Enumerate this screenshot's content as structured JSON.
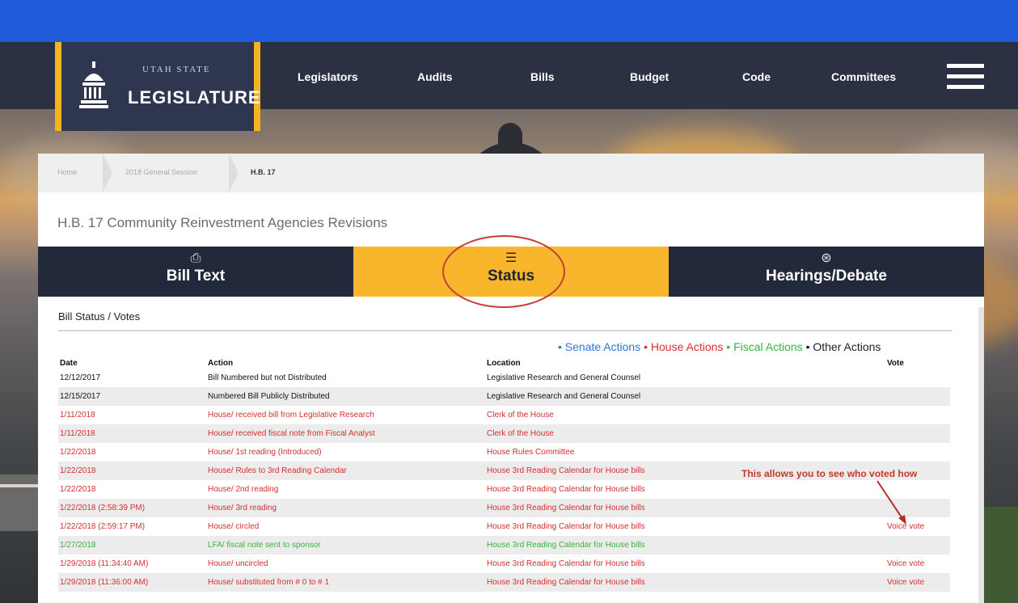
{
  "logo": {
    "top_text": "UTAH STATE",
    "main_text": "LEGISLATURE"
  },
  "nav": {
    "links": [
      "Legislators",
      "Audits",
      "Bills",
      "Budget",
      "Code",
      "Committees"
    ]
  },
  "breadcrumb": [
    "Home",
    "2018 General Session",
    "H.B. 17"
  ],
  "bill": {
    "title": "H.B. 17 Community Reinvestment Agencies Revisions"
  },
  "tabs": [
    {
      "label": "Bill Text",
      "icon": "document-icon"
    },
    {
      "label": "Status",
      "icon": "list-icon"
    },
    {
      "label": "Hearings/Debate",
      "icon": "microphone-icon"
    }
  ],
  "section": {
    "title": "Bill Status / Votes"
  },
  "legend": {
    "bullet": "•",
    "senate": "Senate Actions",
    "house": "House Actions",
    "fiscal": "Fiscal Actions",
    "other": "Other Actions"
  },
  "table": {
    "headers": [
      "Date",
      "Action",
      "Location",
      "Vote"
    ],
    "rows": [
      [
        "12/12/2017",
        "Bill Numbered but not Distributed",
        "Legislative Research and General Counsel",
        ""
      ],
      [
        "12/15/2017",
        "Numbered Bill Publicly Distributed",
        "Legislative Research and General Counsel",
        ""
      ],
      [
        "1/11/2018",
        "House/ received bill from Legislative Research",
        "Clerk of the House",
        ""
      ],
      [
        "1/11/2018",
        "House/ received fiscal note from Fiscal Analyst",
        "Clerk of the House",
        ""
      ],
      [
        "1/22/2018",
        "House/ 1st reading (Introduced)",
        "House Rules Committee",
        ""
      ],
      [
        "1/22/2018",
        "House/ Rules to 3rd Reading Calendar",
        "House 3rd Reading Calendar for House bills",
        ""
      ],
      [
        "1/22/2018",
        "House/ 2nd reading",
        "House 3rd Reading Calendar for House bills",
        ""
      ],
      [
        "1/22/2018 (2:58:39 PM)",
        "House/ 3rd reading",
        "House 3rd Reading Calendar for House bills",
        ""
      ],
      [
        "1/22/2018 (2:59:17 PM)",
        "House/ circled",
        "House 3rd Reading Calendar for House bills",
        "Voice vote"
      ],
      [
        "1/27/2018",
        "LFA/ fiscal note sent to sponsor",
        "House 3rd Reading Calendar for House bills",
        ""
      ],
      [
        "1/29/2018 (11:34:40 AM)",
        "House/ uncircled",
        "House 3rd Reading Calendar for House bills",
        "Voice vote"
      ],
      [
        "1/29/2018 (11:36:00 AM)",
        "House/ substituted from # 0 to # 1",
        "House 3rd Reading Calendar for House bills",
        "Voice vote"
      ]
    ]
  },
  "annotation": {
    "text": "This allows you to see who voted how"
  },
  "colors": {
    "header_blue": "#1f5ad8",
    "nav_dark": "#2b3142",
    "accent_gold": "#f8b62d",
    "senate_blue": "#2f78d0",
    "house_red": "#d92f2f",
    "fiscal_green": "#3cb23f"
  }
}
